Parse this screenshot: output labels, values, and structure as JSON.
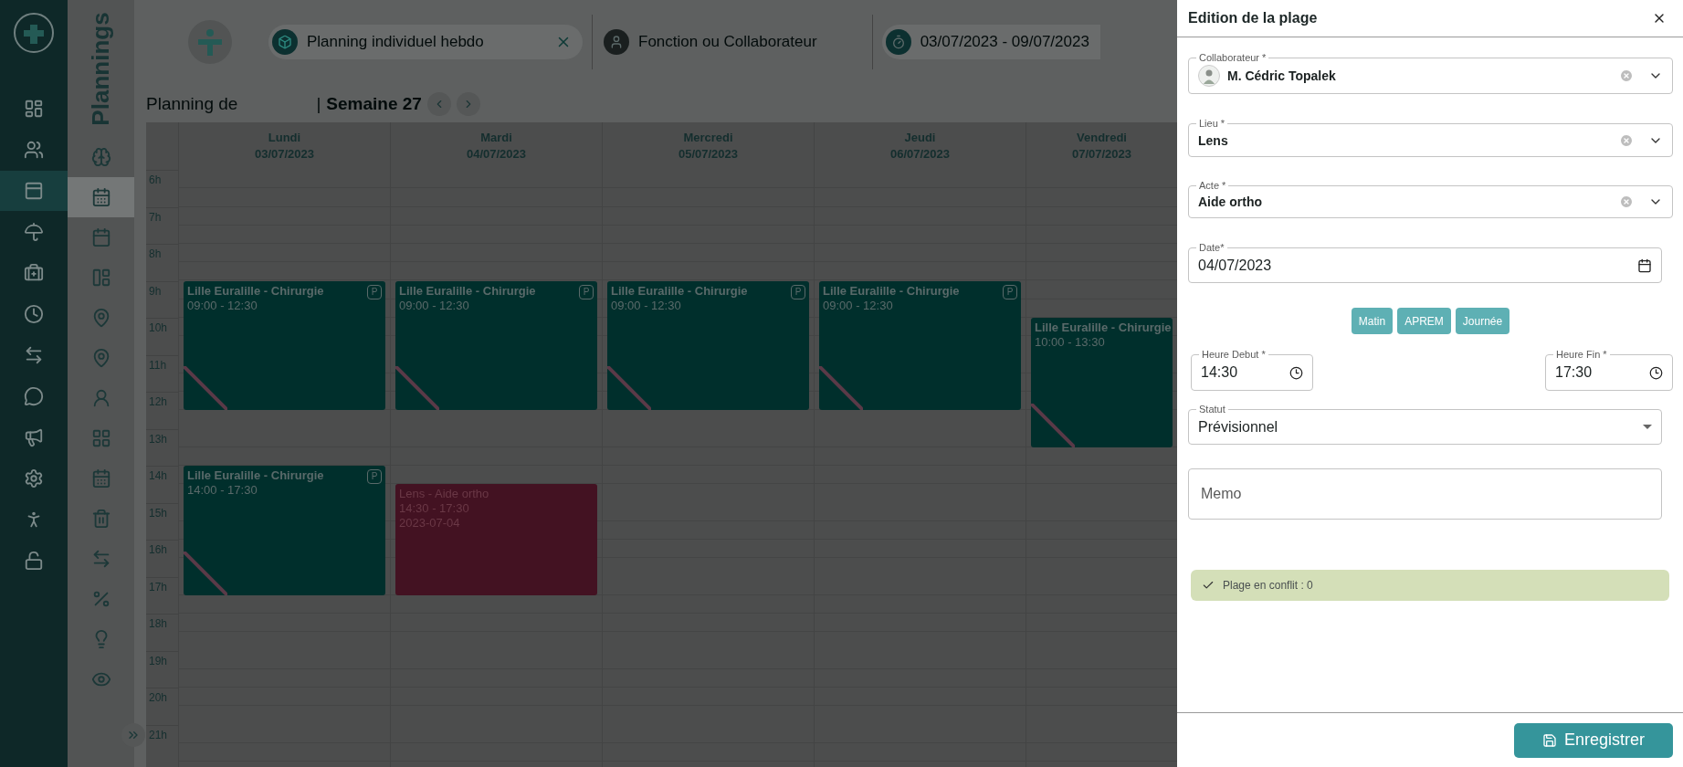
{
  "main_nav": {
    "items": [
      {
        "selected": false
      },
      {
        "selected": false
      },
      {
        "selected": true
      },
      {
        "selected": false
      },
      {
        "selected": false
      },
      {
        "selected": false
      },
      {
        "selected": false
      },
      {
        "selected": false
      },
      {
        "selected": false
      },
      {
        "selected": false
      },
      {
        "selected": false
      },
      {
        "selected": false
      }
    ]
  },
  "section_nav": {
    "title": "Plannings",
    "items": [
      {
        "selected": false
      },
      {
        "selected": true
      },
      {
        "selected": false
      },
      {
        "selected": false
      },
      {
        "selected": false
      },
      {
        "selected": false
      },
      {
        "selected": false
      },
      {
        "selected": false
      },
      {
        "selected": false
      },
      {
        "selected": false
      },
      {
        "selected": false
      },
      {
        "selected": false
      },
      {
        "selected": false
      },
      {
        "selected": false
      }
    ]
  },
  "filters": [
    {
      "kind": "view",
      "label": "Planning individuel hebdo"
    },
    {
      "kind": "person",
      "label": "Fonction ou Collaborateur"
    },
    {
      "kind": "range",
      "label": "03/07/2023 - 09/07/2023"
    }
  ],
  "calendar": {
    "title": "Planning de",
    "separator": "|",
    "week": "Semaine 27",
    "hours": [
      "6h",
      "7h",
      "8h",
      "9h",
      "10h",
      "11h",
      "12h",
      "13h",
      "14h",
      "15h",
      "16h",
      "17h",
      "18h",
      "19h",
      "20h",
      "21h"
    ],
    "days": [
      {
        "name": "Lundi",
        "date": "03/07/2023",
        "events": [
          {
            "kind": "planned",
            "color": "#002f2c",
            "title": "Lille Euralille - Chirurgie",
            "time": "09:00 - 12:30",
            "badge": "P"
          },
          {
            "kind": "planned",
            "color": "#002f2c",
            "title": "Lille Euralille - Chirurgie",
            "time": "14:00 - 17:30",
            "badge": "P"
          }
        ]
      },
      {
        "name": "Mardi",
        "date": "04/07/2023",
        "events": [
          {
            "kind": "planned",
            "color": "#002f2c",
            "title": "Lille Euralille - Chirurgie",
            "time": "09:00 - 12:30",
            "badge": "P"
          },
          {
            "kind": "edited",
            "color": "#431222",
            "title": "Lens - Aide ortho",
            "time": "14:30 - 17:30",
            "date": "2023-07-04"
          }
        ]
      },
      {
        "name": "Mercredi",
        "date": "05/07/2023",
        "events": [
          {
            "kind": "planned",
            "color": "#002f2c",
            "title": "Lille Euralille - Chirurgie",
            "time": "09:00 - 12:30",
            "badge": "P"
          }
        ]
      },
      {
        "name": "Jeudi",
        "date": "06/07/2023",
        "events": [
          {
            "kind": "planned",
            "color": "#002f2c",
            "title": "Lille Euralille - Chirurgie",
            "time": "09:00 - 12:30",
            "badge": "P"
          }
        ]
      },
      {
        "name": "Vendredi",
        "date": "07/07/2023",
        "events": [
          {
            "kind": "planned",
            "color": "#002f2c",
            "title": "Lille Euralille - Chirurgie",
            "time": "10:00 - 13:30"
          }
        ]
      }
    ]
  },
  "panel": {
    "title": "Edition de la plage",
    "selects": [
      {
        "kind": "person",
        "label": "Collaborateur *",
        "value": "M. Cédric Topalek"
      },
      {
        "kind": "plain",
        "label": "Lieu *",
        "value": "Lens"
      },
      {
        "kind": "plain",
        "label": "Acte *",
        "value": "Aide ortho"
      }
    ],
    "date": {
      "label": "Date*",
      "value": "04/07/2023"
    },
    "presets": [
      "Matin",
      "APREM",
      "Journée"
    ],
    "start": {
      "label": "Heure Debut *",
      "value": "14:30"
    },
    "end": {
      "label": "Heure Fin *",
      "value": "17:30"
    },
    "status": {
      "label": "Statut",
      "value": "Prévisionnel"
    },
    "memo": {
      "placeholder": "Memo"
    },
    "alert": "Plage en conflit : 0",
    "save": "Enregistrer"
  }
}
